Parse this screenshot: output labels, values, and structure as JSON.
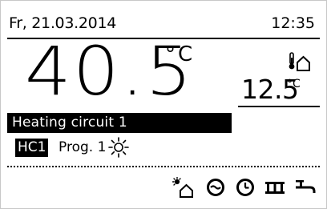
{
  "header": {
    "date": "Fr, 21.03.2014",
    "time": "12:35"
  },
  "main": {
    "room_temperature": "40.5",
    "room_temperature_unit": "°C",
    "outdoor_temperature": "12.5",
    "outdoor_temperature_unit": "°C",
    "outdoor_icon": "outdoor-temperature-icon"
  },
  "circuit": {
    "name": "Heating circuit 1",
    "badge": "HC1",
    "program": "Prog. 1",
    "mode_icon": "sun-icon"
  },
  "bottom_icons": [
    "solar-house-icon",
    "hot-water-icon",
    "clock-icon",
    "heater-icon",
    "faucet-icon"
  ]
}
